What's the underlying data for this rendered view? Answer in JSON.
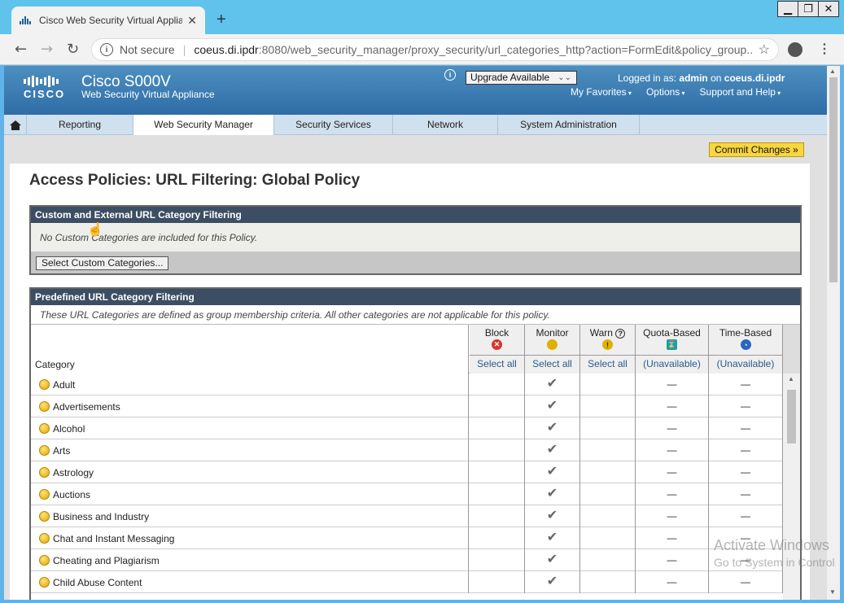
{
  "browser": {
    "tab_title": "Cisco Web Security Virtual Applia",
    "not_secure": "Not secure",
    "url_host": "coeus.di.ipdr",
    "url_rest": ":8080/web_security_manager/proxy_security/url_categories_http?action=FormEdit&policy_group...",
    "new_tab": "+",
    "close_tab": "✕"
  },
  "window_buttons": [
    "▁",
    "❐",
    "✕"
  ],
  "banner": {
    "logo_text": "CISCO",
    "product": "Cisco S000V",
    "subtitle": "Web Security Virtual Appliance",
    "upgrade": "Upgrade Available",
    "logged_prefix": "Logged in as:",
    "user": "admin",
    "on": "on",
    "host": "coeus.di.ipdr",
    "menus": [
      "My Favorites",
      "Options",
      "Support and Help"
    ]
  },
  "nav": {
    "tabs": [
      "Reporting",
      "Web Security Manager",
      "Security Services",
      "Network",
      "System Administration"
    ],
    "active": "Web Security Manager"
  },
  "commit_label": "Commit Changes »",
  "page_title": "Access Policies: URL Filtering: Global Policy",
  "custom_section": {
    "header": "Custom and External URL Category Filtering",
    "note": "No Custom Categories are included for this Policy.",
    "button": "Select Custom Categories..."
  },
  "predefined_section": {
    "header": "Predefined URL Category Filtering",
    "desc": "These URL Categories are defined as group membership criteria. All other categories are not applicable for this policy.",
    "category_header": "Category",
    "columns": [
      {
        "label": "Block",
        "select": "Select all",
        "icon": "block-icon",
        "color": "#d9342b"
      },
      {
        "label": "Monitor",
        "select": "Select all",
        "icon": "monitor-icon",
        "color": "#e0b000"
      },
      {
        "label": "Warn",
        "select": "Select all",
        "icon": "warn-icon",
        "color": "#e0b000"
      },
      {
        "label": "Quota-Based",
        "select": "(Unavailable)",
        "icon": "quota-icon",
        "color": "#1aa1a1"
      },
      {
        "label": "Time-Based",
        "select": "(Unavailable)",
        "icon": "time-icon",
        "color": "#2a66c0"
      }
    ],
    "rows": [
      {
        "name": "Adult",
        "quota": "—",
        "time": "—"
      },
      {
        "name": "Advertisements",
        "quota": "—",
        "time": "—"
      },
      {
        "name": "Alcohol",
        "quota": "—",
        "time": "—"
      },
      {
        "name": "Arts",
        "quota": "—",
        "time": "—"
      },
      {
        "name": "Astrology",
        "quota": "—",
        "time": "—"
      },
      {
        "name": "Auctions",
        "quota": "—",
        "time": "—"
      },
      {
        "name": "Business and Industry",
        "quota": "—",
        "time": "—"
      },
      {
        "name": "Chat and Instant Messaging",
        "quota": "—",
        "time": "—"
      },
      {
        "name": "Cheating and Plagiarism",
        "quota": "—",
        "time": "—"
      },
      {
        "name": "Child Abuse Content",
        "quota": "—",
        "time": "—"
      }
    ],
    "monitor_check": "✔"
  },
  "watermark": {
    "line1": "Activate Windows",
    "line2": "Go to System in Control"
  }
}
